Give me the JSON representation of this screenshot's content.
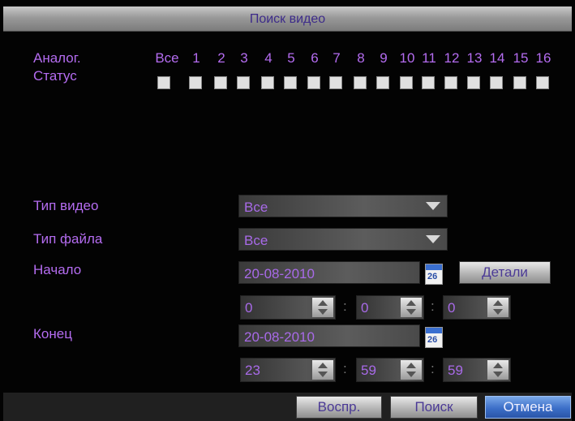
{
  "dialog": {
    "title": "Поиск видео"
  },
  "channels": {
    "row_label": "Аналог.",
    "status_label": "Статус",
    "all_label": "Все",
    "items": [
      "1",
      "2",
      "3",
      "4",
      "5",
      "6",
      "7",
      "8",
      "9",
      "10",
      "11",
      "12",
      "13",
      "14",
      "15",
      "16"
    ]
  },
  "video_type": {
    "label": "Тип видео",
    "value": "Все"
  },
  "file_type": {
    "label": "Тип файла",
    "value": "Все"
  },
  "start": {
    "label": "Начало",
    "date": "20-08-2010",
    "calendar_day": "26",
    "details_button": "Детали",
    "hour": "0",
    "minute": "0",
    "second": "0"
  },
  "end": {
    "label": "Конец",
    "date": "20-08-2010",
    "calendar_day": "26",
    "hour": "23",
    "minute": "59",
    "second": "59"
  },
  "time_separator": ":",
  "buttons": {
    "play": "Воспр.",
    "search": "Поиск",
    "cancel": "Отмена"
  },
  "colors": {
    "label_text": "#b46cf0",
    "selected_button": "#3c6fc8"
  }
}
